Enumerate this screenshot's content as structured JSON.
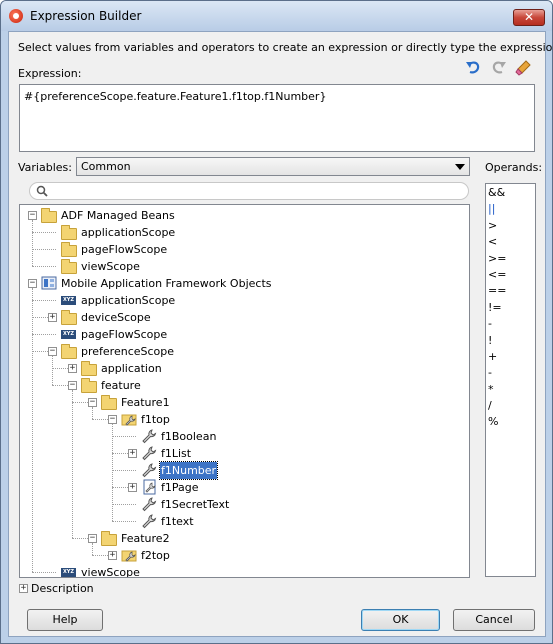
{
  "window": {
    "title": "Expression Builder",
    "close_glyph": "✕"
  },
  "intro": "Select values from variables and operators to create an expression or directly type the expression here:",
  "expression": {
    "label": "Expression:",
    "value": "#{preferenceScope.feature.Feature1.f1top.f1Number}"
  },
  "toolbar": {
    "icons": [
      "undo-icon",
      "redo-icon",
      "clear-icon"
    ]
  },
  "variables": {
    "label": "Variables:",
    "selected": "Common",
    "search_placeholder": ""
  },
  "operands": {
    "label": "Operands:",
    "items": [
      "&&",
      "||",
      ">",
      "<",
      ">=",
      "<=",
      "==",
      "!=",
      "-",
      "!",
      "+",
      "-",
      "*",
      "/",
      "%"
    ]
  },
  "tree": [
    {
      "label": "ADF Managed Beans",
      "icon": "folder-icon",
      "expanded": true
    },
    {
      "label": "applicationScope",
      "icon": "folder-icon"
    },
    {
      "label": "pageFlowScope",
      "icon": "folder-icon"
    },
    {
      "label": "viewScope",
      "icon": "folder-icon"
    },
    {
      "label": "Mobile Application Framework Objects",
      "icon": "mobile-objects-icon",
      "expanded": true
    },
    {
      "label": "applicationScope",
      "icon": "xyz-icon"
    },
    {
      "label": "deviceScope",
      "icon": "folder-icon",
      "expanded": false
    },
    {
      "label": "pageFlowScope",
      "icon": "xyz-icon"
    },
    {
      "label": "preferenceScope",
      "icon": "folder-icon",
      "expanded": true
    },
    {
      "label": "application",
      "icon": "folder-icon",
      "expanded": false
    },
    {
      "label": "feature",
      "icon": "folder-icon",
      "expanded": true
    },
    {
      "label": "Feature1",
      "icon": "folder-icon",
      "expanded": true
    },
    {
      "label": "f1top",
      "icon": "bean-folder-icon",
      "expanded": true
    },
    {
      "label": "f1Boolean",
      "icon": "wrench-icon"
    },
    {
      "label": "f1List",
      "icon": "wrench-icon",
      "expanded": false
    },
    {
      "label": "f1Number",
      "icon": "wrench-icon",
      "selected": true
    },
    {
      "label": "f1Page",
      "icon": "bean-page-icon",
      "expanded": false
    },
    {
      "label": "f1SecretText",
      "icon": "wrench-icon"
    },
    {
      "label": "f1text",
      "icon": "wrench-icon"
    },
    {
      "label": "Feature2",
      "icon": "folder-icon",
      "expanded": true
    },
    {
      "label": "f2top",
      "icon": "bean-folder-icon",
      "expanded": false
    },
    {
      "label": "viewScope",
      "icon": "xyz-icon"
    }
  ],
  "description": {
    "label": "Description",
    "expanded": false
  },
  "buttons": {
    "help": "Help",
    "ok": "OK",
    "cancel": "Cancel"
  },
  "colors": {
    "selection": "#3d74c6",
    "titlebar": "#bcd0e8",
    "close": "#c8473a"
  }
}
